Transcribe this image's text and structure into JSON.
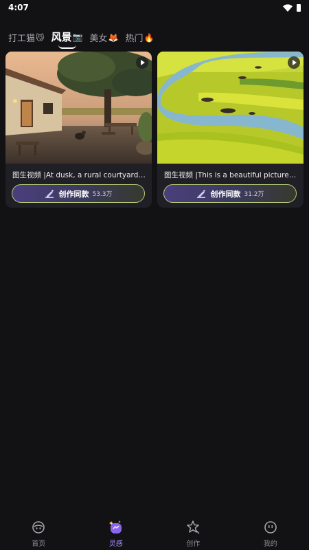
{
  "status": {
    "time": "4:07"
  },
  "tabs": [
    {
      "label": "打工猫",
      "emoji": "😼",
      "active": false
    },
    {
      "label": "风景",
      "emoji": "📷",
      "active": true
    },
    {
      "label": "美女",
      "emoji": "🦊",
      "active": false
    },
    {
      "label": "热门",
      "emoji": "🔥",
      "active": false
    }
  ],
  "cards": [
    {
      "title": "图生视频 |At dusk, a rural courtyard sce...",
      "button_label": "创作同款",
      "count": "53.3万"
    },
    {
      "title": "图生视频 |This is a beautiful picture of ...",
      "button_label": "创作同款",
      "count": "31.2万"
    }
  ],
  "nav": [
    {
      "label": "首页",
      "icon": "home-icon",
      "active": false
    },
    {
      "label": "灵感",
      "icon": "inspiration-icon",
      "active": true
    },
    {
      "label": "创作",
      "icon": "create-icon",
      "active": false
    },
    {
      "label": "我的",
      "icon": "profile-icon",
      "active": false
    }
  ],
  "colors": {
    "accent": "#a98bff",
    "button_border": "#b8cf7a",
    "background": "#121214"
  }
}
